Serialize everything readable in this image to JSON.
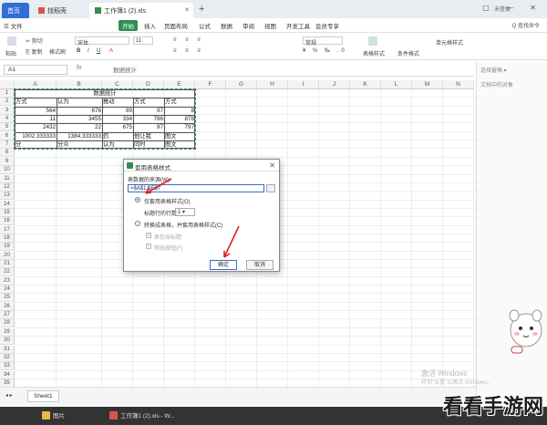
{
  "titlebar": {
    "tabs": [
      {
        "label": "首页"
      },
      {
        "label": "找稻壳"
      },
      {
        "label": "工作簿1 (2).xls"
      }
    ],
    "login": "未登录"
  },
  "menubar": {
    "file": "文件",
    "items": [
      "开始",
      "插入",
      "页面布局",
      "公式",
      "数据",
      "审阅",
      "视图",
      "开发工具",
      "会员专享"
    ],
    "right": "Q 查找命令"
  },
  "toolbar": {
    "cut": "剪切",
    "copy": "复制",
    "paste": "粘贴",
    "format_painter": "格式刷",
    "font": "宋体",
    "font_size": "11",
    "number_format": "常规",
    "table_style": "表格样式",
    "condition_format": "条件格式",
    "cell_style": "单元格样式"
  },
  "formula": {
    "cell_ref": "A1",
    "fx": "fx",
    "content": "数据统计"
  },
  "grid": {
    "columns": [
      "A",
      "B",
      "C",
      "D",
      "E",
      "F",
      "G",
      "H",
      "I",
      "J",
      "K",
      "L",
      "M",
      "N"
    ],
    "rows": [
      "1",
      "2",
      "3",
      "4",
      "5",
      "6",
      "7",
      "8",
      "9",
      "10",
      "11",
      "12",
      "13",
      "14",
      "15",
      "16",
      "17",
      "18",
      "19",
      "20",
      "21",
      "22",
      "23",
      "24",
      "25",
      "26",
      "27",
      "28",
      "29",
      "30",
      "31",
      "32",
      "33",
      "34",
      "35",
      "36",
      "37"
    ],
    "title": "数据统计",
    "header": [
      "方式",
      "认为",
      "推动",
      "方式",
      "方式"
    ],
    "r3": [
      "564",
      "676",
      "89",
      "97",
      "8"
    ],
    "r4": [
      "11",
      "3455",
      "334",
      "786",
      "878"
    ],
    "r5": [
      "2432",
      "22",
      "675",
      "97",
      "797"
    ],
    "r6": [
      "1002.333333",
      "1384.333333",
      "药",
      "他让我",
      "图文"
    ],
    "r7": [
      "分",
      "分众",
      "认为",
      "同时",
      "图文"
    ]
  },
  "dialog": {
    "title": "套用表格样式",
    "source_label": "表数据的来源(W):",
    "source_value": "=$A$1:$E$7",
    "option1": "仅套用表格样式(O)",
    "rows_label": "标题行的行数:",
    "rows_value": "1",
    "option2": "转换成表格，并套用表格样式(C)",
    "check1": "表包含标题",
    "check2": "筛选按钮(F)",
    "ok": "确定",
    "cancel": "取消"
  },
  "rightpane": {
    "title": "选择窗格 ▾",
    "sub": "文档中的对象"
  },
  "sheetbar": {
    "sheet": "Sheet1"
  },
  "watermark": {
    "line1": "激活 Windows",
    "line2": "转到\"设置\"以激活 Windows。"
  },
  "taskbar": {
    "items": [
      "图片",
      "工作簿1 (2).xls - W..."
    ]
  },
  "brand": "看看手游网",
  "colors": {
    "accent": "#2f8f4e",
    "tab_blue": "#2f6fd6",
    "arrow": "#e02020"
  }
}
